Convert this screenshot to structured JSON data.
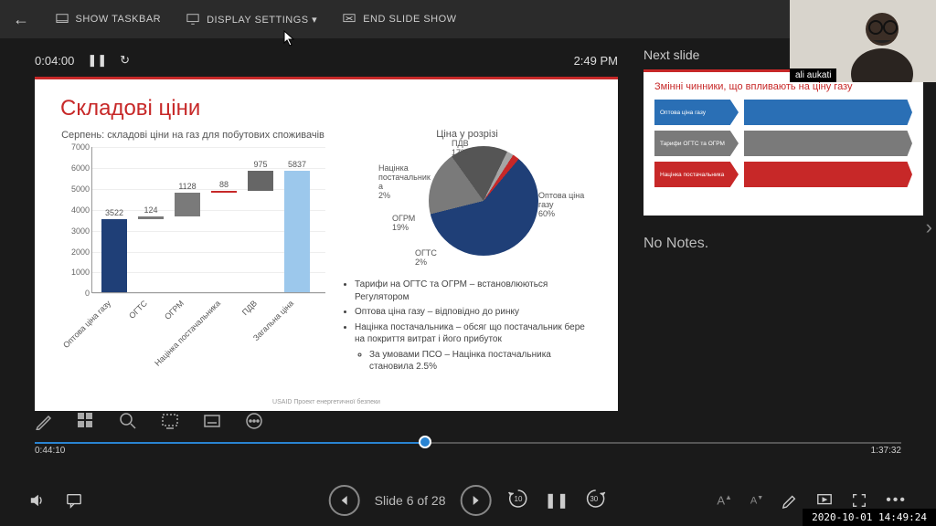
{
  "topbar": {
    "show_taskbar": "SHOW TASKBAR",
    "display_settings": "DISPLAY SETTINGS ▾",
    "end_slideshow": "END SLIDE SHOW"
  },
  "timer": {
    "elapsed": "0:04:00",
    "clock": "2:49 PM"
  },
  "slide": {
    "title": "Складові ціни",
    "bar_title": "Серпень: складові ціни на газ для побутових споживачів",
    "pie_title": "Ціна у розрізі",
    "bullets": [
      "Тарифи на ОГТС та ОГРМ – встановлюються Регулятором",
      "Оптова ціна газу – відповідно до ринку",
      "Націнка постачальника – обсяг що постачальник бере на покриття витрат і його прибуток"
    ],
    "sub_bullet": "За умовами ПСО – Націнка постачальника становила 2.5%",
    "footer": "USAID Проект енергетичної безпеки"
  },
  "chart_data": {
    "bar": {
      "type": "bar",
      "title": "Серпень: складові ціни на газ для побутових споживачів",
      "ylabel": "",
      "ylim": [
        0,
        7000
      ],
      "yticks": [
        0,
        1000,
        2000,
        3000,
        4000,
        5000,
        6000,
        7000
      ],
      "categories": [
        "Оптова ціна газу",
        "ОГТС",
        "ОГРМ",
        "Націнка постачальника",
        "ПДВ",
        "Загальна ціна"
      ],
      "values": [
        3522,
        124,
        1128,
        88,
        975,
        5837
      ],
      "cumulative_base": [
        0,
        3522,
        3646,
        4774,
        4862,
        0
      ],
      "colors": [
        "#1f3f77",
        "#7a7a7a",
        "#7a7a7a",
        "#c72828",
        "#666",
        "#9cc8ec"
      ],
      "is_total": [
        false,
        false,
        false,
        false,
        false,
        true
      ]
    },
    "pie": {
      "type": "pie",
      "title": "Ціна у розрізі",
      "series": [
        {
          "name": "Оптова ціна газу",
          "value": 60,
          "color": "#1f3f77"
        },
        {
          "name": "ОГРМ",
          "value": 19,
          "color": "#7a7a7a"
        },
        {
          "name": "ПДВ",
          "value": 17,
          "color": "#555"
        },
        {
          "name": "Націнка постачальника",
          "value": 2,
          "color": "#a5a5a5"
        },
        {
          "name": "ОГТС",
          "value": 2,
          "color": "#c72828"
        }
      ]
    }
  },
  "next": {
    "heading": "Next slide",
    "title": "Змінні чинники, що впливають на ціну газу",
    "rows": [
      {
        "badge": "Оптова ціна газу",
        "bcolor": "#2a6fb5",
        "dcolor": "#2a6fb5"
      },
      {
        "badge": "Тарифи ОГТС та ОГРМ",
        "bcolor": "#7a7a7a",
        "dcolor": "#7a7a7a"
      },
      {
        "badge": "Націнка постачальника",
        "bcolor": "#c72828",
        "dcolor": "#c72828"
      }
    ]
  },
  "notes": "No Notes.",
  "scrub": {
    "current": "0:44:10",
    "total": "1:37:32",
    "pct": 45
  },
  "player": {
    "slide_label": "Slide 6 of 28",
    "skip_back": "10",
    "skip_fwd": "30"
  },
  "webcam": {
    "name": "ali aukati"
  },
  "datetime": "2020-10-01 14:49:24"
}
